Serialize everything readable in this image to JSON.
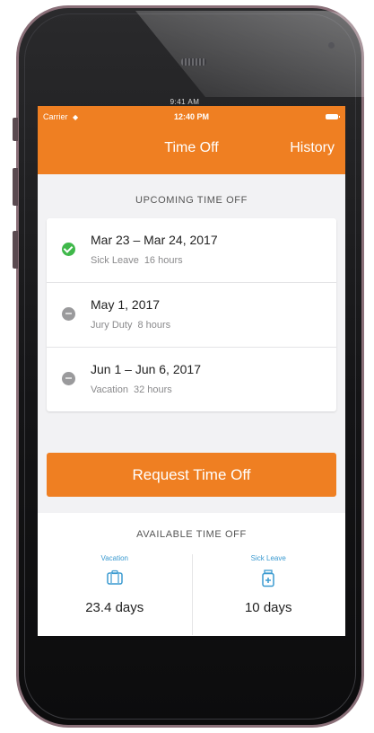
{
  "device": {
    "label": "9:41 AM"
  },
  "status_bar": {
    "carrier": "Carrier",
    "time": "12:40 PM"
  },
  "nav": {
    "title": "Time Off",
    "history_label": "History"
  },
  "upcoming": {
    "title": "UPCOMING TIME OFF",
    "items": [
      {
        "dates": "Mar 23 – Mar 24, 2017",
        "type": "Sick Leave",
        "hours": "16 hours",
        "status": "approved"
      },
      {
        "dates": "May 1, 2017",
        "type": "Jury Duty",
        "hours": "8 hours",
        "status": "pending"
      },
      {
        "dates": "Jun 1 – Jun 6, 2017",
        "type": "Vacation",
        "hours": "32 hours",
        "status": "pending"
      }
    ]
  },
  "request_button": {
    "label": "Request Time Off"
  },
  "available": {
    "title": "AVAILABLE TIME OFF",
    "columns": [
      {
        "label": "Vacation",
        "icon": "suitcase-icon",
        "value": "23.4 days"
      },
      {
        "label": "Sick Leave",
        "icon": "medicine-bottle-icon",
        "value": "10 days"
      }
    ]
  },
  "colors": {
    "accent": "#ef7f22",
    "approved": "#3fb84a",
    "pending": "#9a9a9c",
    "link": "#3a9ad0"
  }
}
